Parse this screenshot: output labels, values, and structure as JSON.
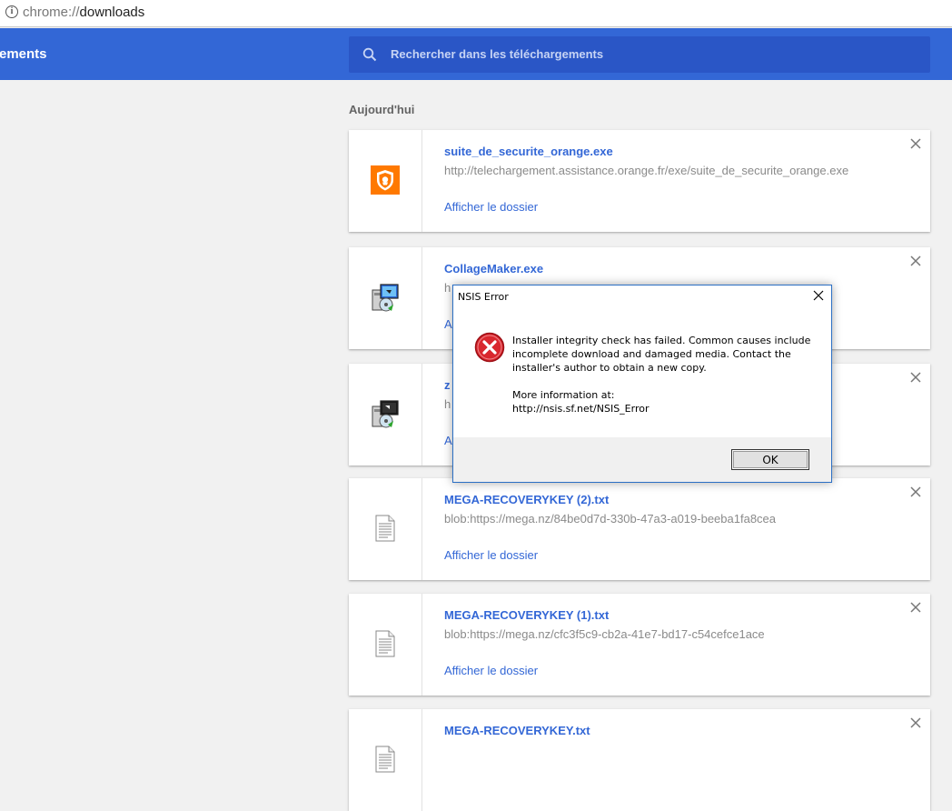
{
  "address_bar": {
    "scheme": "chrome://",
    "path": "downloads"
  },
  "header": {
    "title": "ements",
    "search_placeholder": "Rechercher dans les téléchargements"
  },
  "section": {
    "label": "Aujourd'hui"
  },
  "downloads": [
    {
      "name": "suite_de_securite_orange.exe",
      "url": "http://telechargement.assistance.orange.fr/exe/suite_de_securite_orange.exe",
      "action": "Afficher le dossier",
      "icon": "orange-shield-icon"
    },
    {
      "name": "CollageMaker.exe",
      "url": "h",
      "action": "A",
      "icon": "installer-icon"
    },
    {
      "name": "z",
      "url": "h",
      "action": "A",
      "icon": "installer-icon"
    },
    {
      "name": "MEGA-RECOVERYKEY (2).txt",
      "url": "blob:https://mega.nz/84be0d7d-330b-47a3-a019-beeba1fa8cea",
      "action": "Afficher le dossier",
      "icon": "text-file-icon"
    },
    {
      "name": "MEGA-RECOVERYKEY (1).txt",
      "url": "blob:https://mega.nz/cfc3f5c9-cb2a-41e7-bd17-c54cefce1ace",
      "action": "Afficher le dossier",
      "icon": "text-file-icon"
    },
    {
      "name": "MEGA-RECOVERYKEY.txt",
      "url": "",
      "action": "",
      "icon": "text-file-icon"
    }
  ],
  "dialog": {
    "title": "NSIS Error",
    "message": "Installer integrity check has failed. Common causes include incomplete download and damaged media. Contact the installer's author to obtain a new copy.",
    "more_label": "More information at:",
    "more_url": "http://nsis.sf.net/NSIS_Error",
    "ok_label": "OK"
  },
  "colors": {
    "accent": "#3367d6",
    "toolbar": "#3367d6",
    "search_bg": "#2a56c6",
    "orange": "#ff7900",
    "error_red": "#d9272e"
  }
}
